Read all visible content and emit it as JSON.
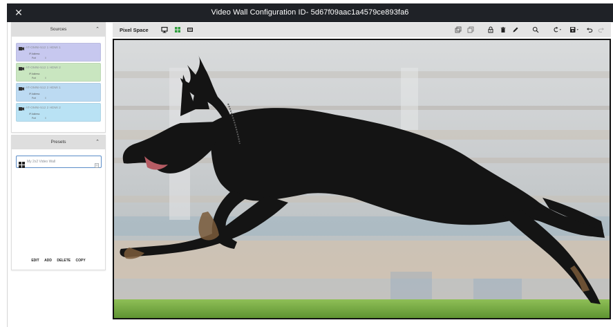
{
  "window": {
    "title": "Video Wall Configuration ID- 5d67f09aac1a4579ce893fa6",
    "close_glyph": "✕"
  },
  "sources": {
    "header": "Sources",
    "items": [
      {
        "name": "AT-OMNI-512 1 HDMI 1",
        "ip_label": "IP Address",
        "port_label": "Port",
        "port_value": "0",
        "color": "#c7c8ef"
      },
      {
        "name": "AT-OMNI-512 1 HDMI 2",
        "ip_label": "IP Address",
        "port_label": "Port",
        "port_value": "0",
        "color": "#c9e6c0"
      },
      {
        "name": "AT-OMNI-512 2 HDMI 1",
        "ip_label": "IP Address",
        "port_label": "Port",
        "port_value": "0",
        "color": "#bcdaf2"
      },
      {
        "name": "AT-OMNI-512 2 HDMI 2",
        "ip_label": "IP Address",
        "port_label": "Port",
        "port_value": "0",
        "color": "#b9e2f4"
      }
    ]
  },
  "presets": {
    "header": "Presets",
    "items": [
      {
        "name": "My 2x2 Video Wall"
      }
    ],
    "actions": {
      "edit": "EDIT",
      "add": "ADD",
      "delete": "DELETE",
      "copy": "COPY"
    }
  },
  "toolbar": {
    "label": "Pixel Space",
    "accent": "#2e9e3c"
  },
  "canvas": {
    "content": "dog-photo"
  }
}
